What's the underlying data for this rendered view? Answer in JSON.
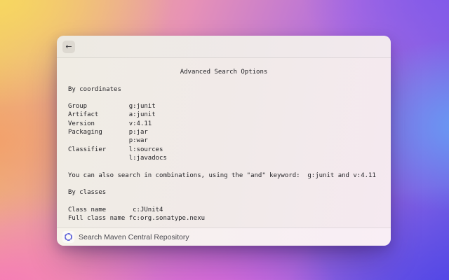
{
  "window": {
    "titlebar": {
      "back_icon": "←"
    },
    "page_title": "Advanced Search Options",
    "coordinates": {
      "heading": "By coordinates",
      "rows": [
        {
          "label": "Group",
          "value": "g:junit"
        },
        {
          "label": "Artifact",
          "value": "a:junit"
        },
        {
          "label": "Version",
          "value": "v:4.11"
        },
        {
          "label": "Packaging",
          "value": "p:jar"
        },
        {
          "label": "",
          "value": "p:war"
        },
        {
          "label": "Classifier",
          "value": "l:sources"
        },
        {
          "label": "",
          "value": "l:javadocs"
        }
      ]
    },
    "combination_note": "You can also search in combinations, using the \"and\" keyword:  g:junit and v:4.11",
    "classes": {
      "heading": "By classes",
      "rows": [
        {
          "label": "Class name",
          "value": "c:JUnit4"
        },
        {
          "label": "Full class name",
          "value": "fc:org.sonatype.nexu"
        }
      ]
    },
    "footer": {
      "search_label": "Search Maven Central Repository",
      "spinner_color": "#5b5fd8"
    }
  }
}
